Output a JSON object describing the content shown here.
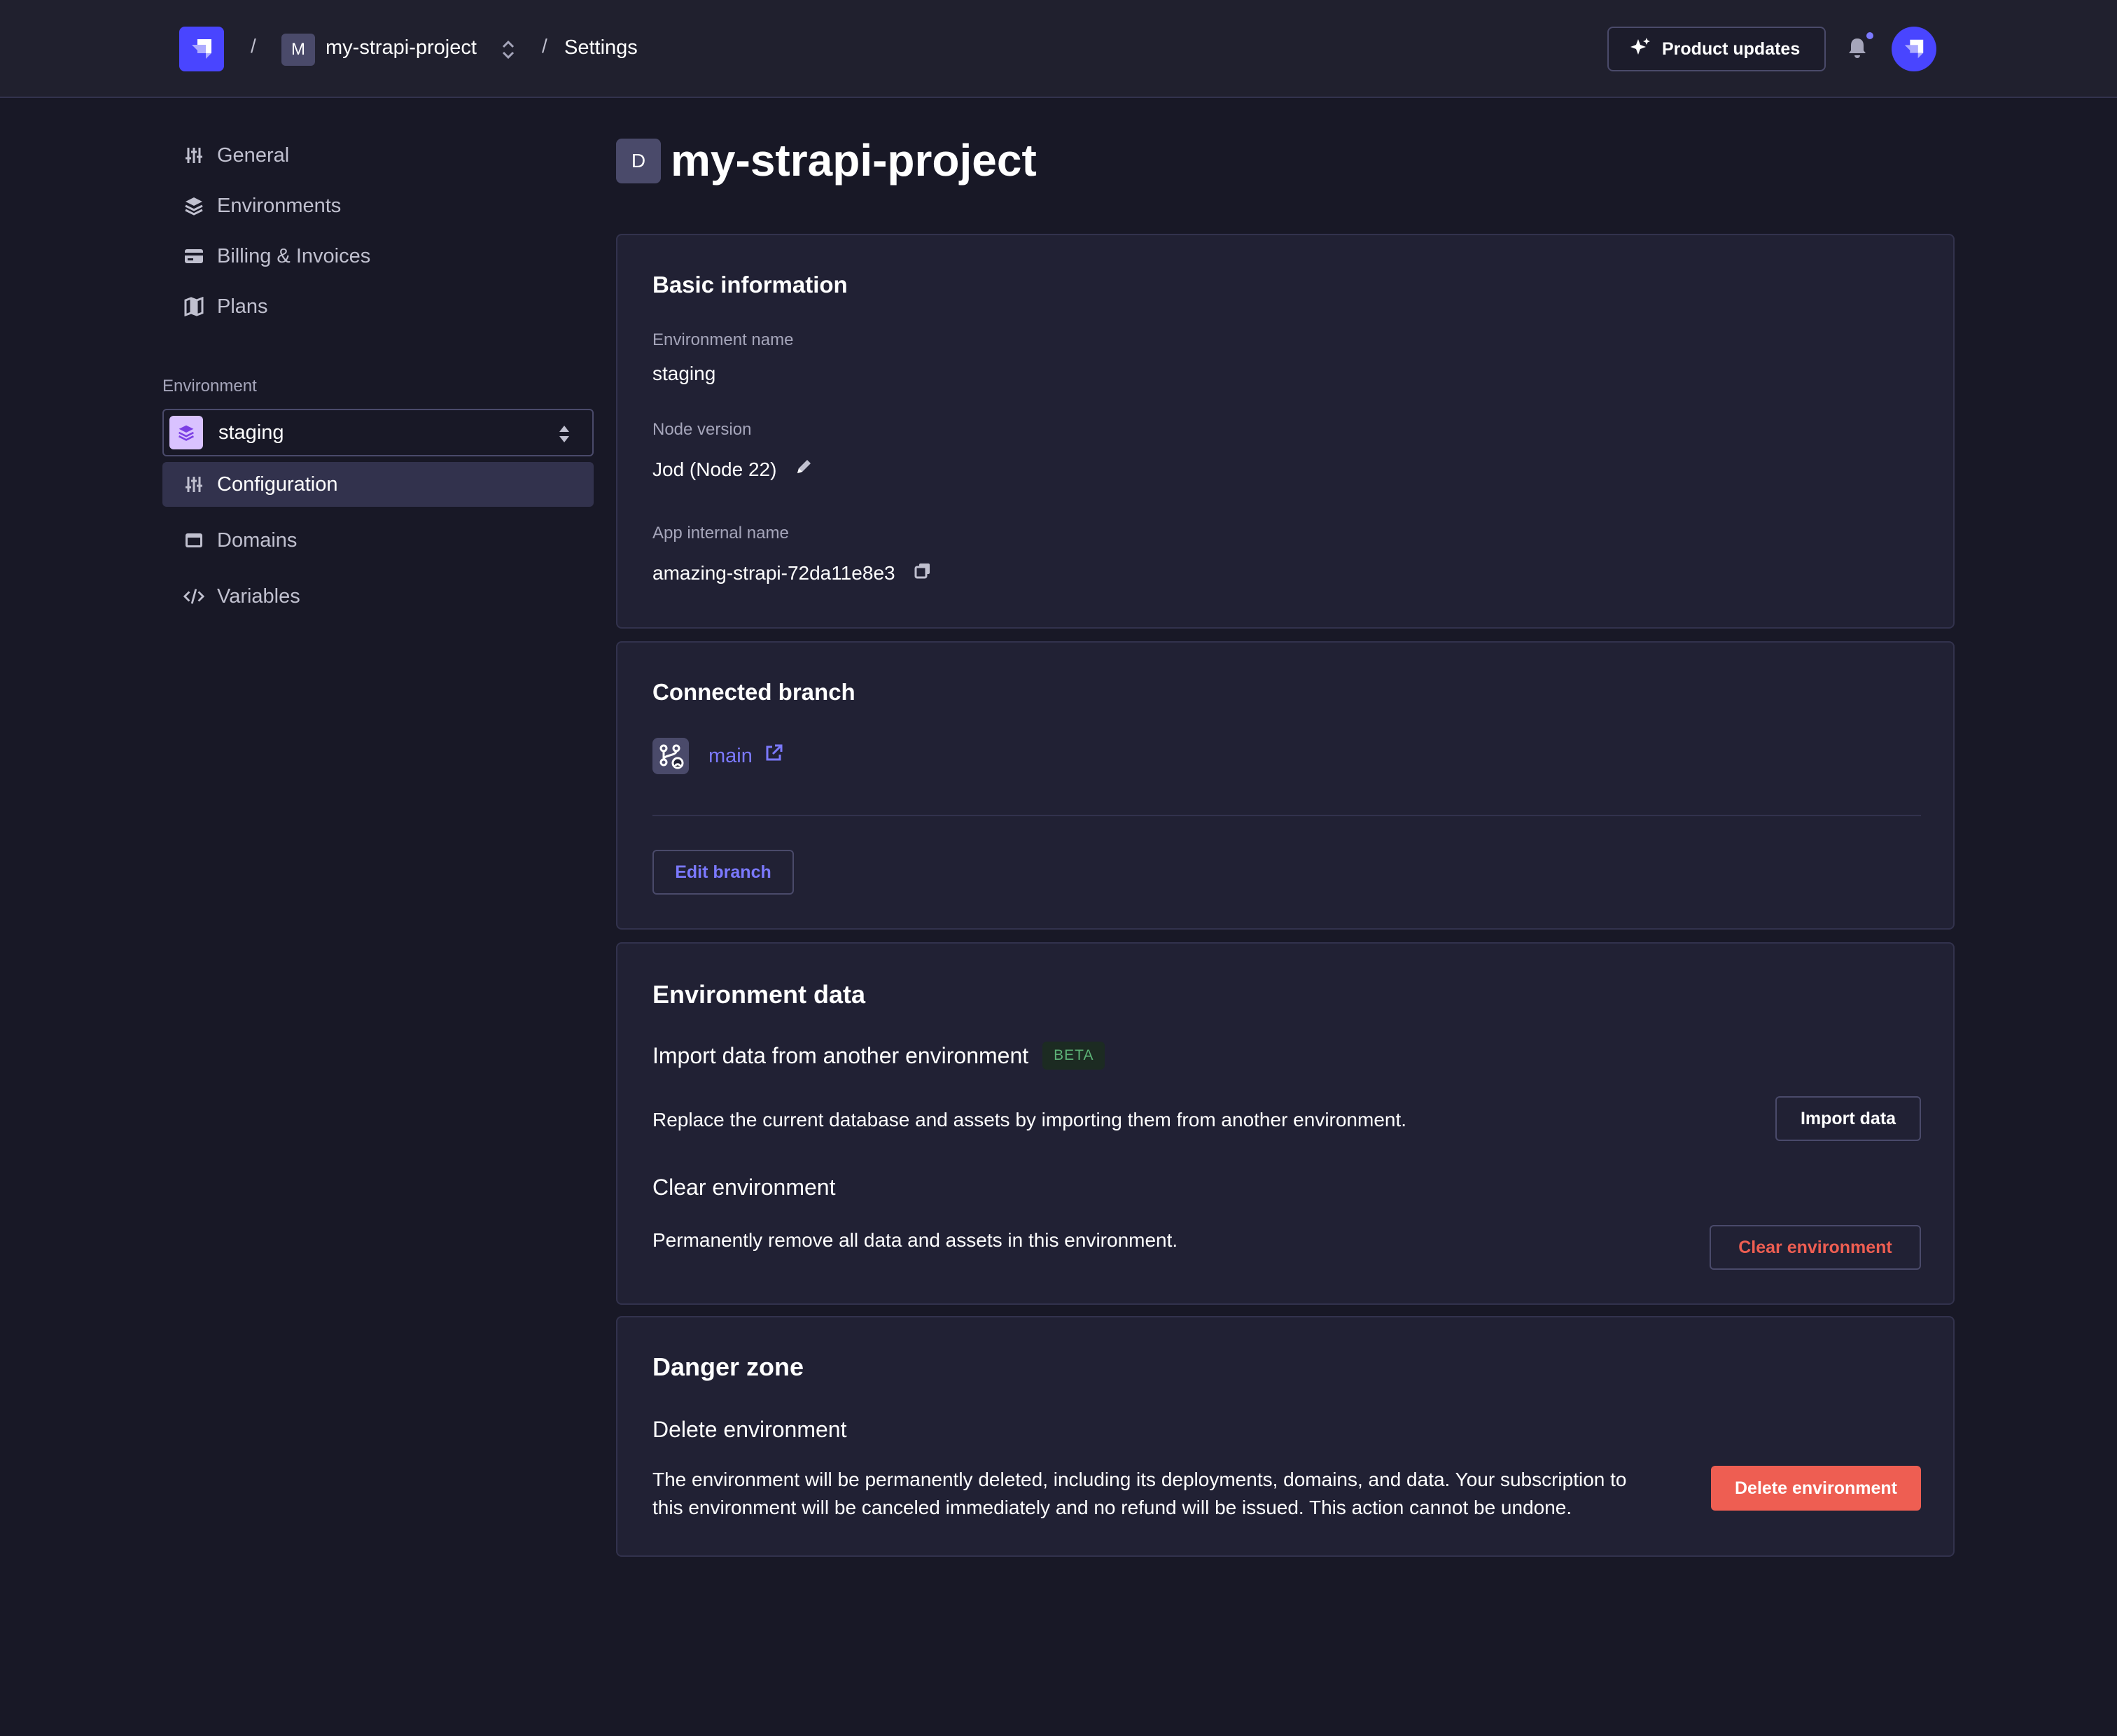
{
  "header": {
    "project_initial": "M",
    "project_name": "my-strapi-project",
    "separator": "/",
    "current_page": "Settings",
    "product_updates_label": "Product updates"
  },
  "sidebar": {
    "items": [
      {
        "label": "General",
        "icon": "sliders-icon"
      },
      {
        "label": "Environments",
        "icon": "layers-icon"
      },
      {
        "label": "Billing & Invoices",
        "icon": "credit-card-icon"
      },
      {
        "label": "Plans",
        "icon": "map-icon"
      }
    ],
    "environment_label": "Environment",
    "environment_selected": "staging",
    "env_items": [
      {
        "label": "Configuration",
        "icon": "sliders-icon",
        "active": true
      },
      {
        "label": "Domains",
        "icon": "window-icon",
        "active": false
      },
      {
        "label": "Variables",
        "icon": "code-icon",
        "active": false
      }
    ]
  },
  "page": {
    "initial": "D",
    "title": "my-strapi-project"
  },
  "basic_info": {
    "title": "Basic information",
    "env_name_label": "Environment name",
    "env_name_value": "staging",
    "node_label": "Node version",
    "node_value": "Jod (Node 22)",
    "internal_label": "App internal name",
    "internal_value": "amazing-strapi-72da11e8e3"
  },
  "branch": {
    "title": "Connected branch",
    "branch_name": "main",
    "edit_label": "Edit branch"
  },
  "env_data": {
    "title": "Environment data",
    "import_title": "Import data from another environment",
    "beta_label": "BETA",
    "import_desc": "Replace the current database and assets by importing them from another environment.",
    "import_button": "Import data",
    "clear_title": "Clear environment",
    "clear_desc": "Permanently remove all data and assets in this environment.",
    "clear_button": "Clear environment"
  },
  "danger": {
    "title": "Danger zone",
    "delete_title": "Delete environment",
    "delete_desc_1": "The environment will be permanently deleted, including its deployments, domains, and data. Your subscription to",
    "delete_desc_2": "this environment will be canceled immediately and no refund will be issued. This action cannot be undone.",
    "delete_button": "Delete environment"
  },
  "colors": {
    "primary": "#4945ff",
    "link": "#7b79ff",
    "danger": "#ee5e52",
    "success": "#5cb176"
  }
}
